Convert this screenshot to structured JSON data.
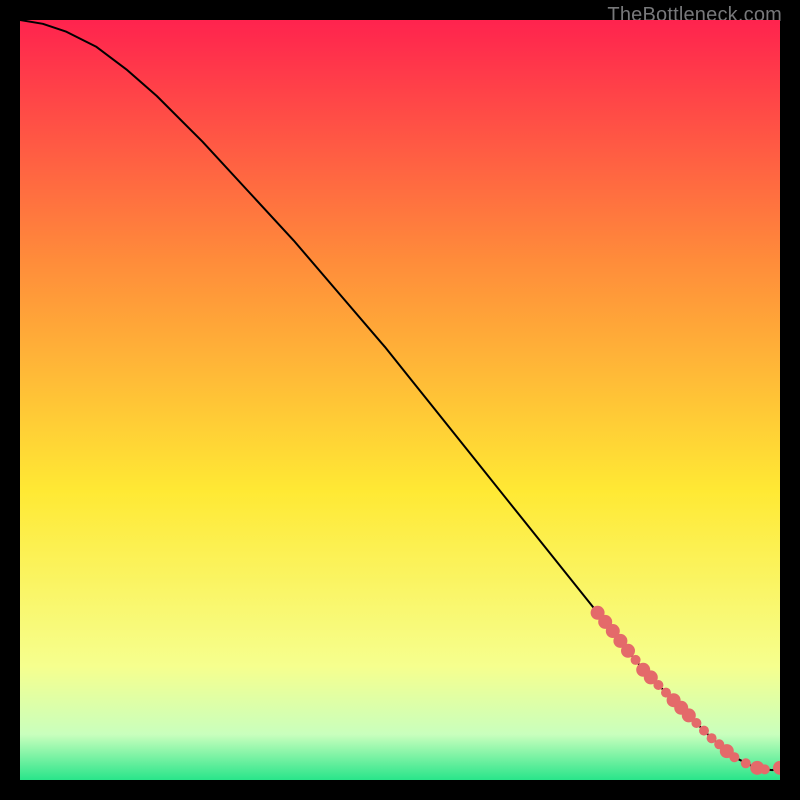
{
  "watermark": "TheBottleneck.com",
  "chart_data": {
    "type": "line",
    "title": "",
    "xlabel": "",
    "ylabel": "",
    "xlim": [
      0,
      100
    ],
    "ylim": [
      0,
      100
    ],
    "grid": false,
    "background_gradient": {
      "top": "#ff234e",
      "mid1": "#ff8d3a",
      "mid2": "#ffe934",
      "mid3": "#f6ff8e",
      "mid4": "#c9ffbd",
      "bottom": "#29e58a"
    },
    "series": [
      {
        "name": "bottleneck-curve",
        "x": [
          0,
          3,
          6,
          10,
          14,
          18,
          24,
          30,
          36,
          42,
          48,
          54,
          60,
          66,
          72,
          76,
          80,
          82,
          85,
          88,
          91,
          94,
          97,
          99,
          100
        ],
        "y": [
          100,
          99.5,
          98.5,
          96.5,
          93.5,
          90,
          84,
          77.5,
          71,
          64,
          57,
          49.5,
          42,
          34.5,
          27,
          22,
          17,
          14.5,
          11.5,
          8.5,
          5.5,
          3,
          1.5,
          1.3,
          1.6
        ],
        "stroke": "#000000",
        "stroke_width": 2
      }
    ],
    "markers": {
      "name": "highlight-dots",
      "color": "#e46a6a",
      "radius_small": 5,
      "radius_large": 7,
      "points": [
        {
          "x": 76.0,
          "y": 22.0,
          "r": 7
        },
        {
          "x": 77.0,
          "y": 20.8,
          "r": 7
        },
        {
          "x": 78.0,
          "y": 19.6,
          "r": 7
        },
        {
          "x": 79.0,
          "y": 18.3,
          "r": 7
        },
        {
          "x": 80.0,
          "y": 17.0,
          "r": 7
        },
        {
          "x": 81.0,
          "y": 15.8,
          "r": 5
        },
        {
          "x": 82.0,
          "y": 14.5,
          "r": 7
        },
        {
          "x": 83.0,
          "y": 13.5,
          "r": 7
        },
        {
          "x": 84.0,
          "y": 12.5,
          "r": 5
        },
        {
          "x": 85.0,
          "y": 11.5,
          "r": 5
        },
        {
          "x": 86.0,
          "y": 10.5,
          "r": 7
        },
        {
          "x": 87.0,
          "y": 9.5,
          "r": 7
        },
        {
          "x": 88.0,
          "y": 8.5,
          "r": 7
        },
        {
          "x": 89.0,
          "y": 7.5,
          "r": 5
        },
        {
          "x": 90.0,
          "y": 6.5,
          "r": 5
        },
        {
          "x": 91.0,
          "y": 5.5,
          "r": 5
        },
        {
          "x": 92.0,
          "y": 4.7,
          "r": 5
        },
        {
          "x": 93.0,
          "y": 3.8,
          "r": 7
        },
        {
          "x": 94.0,
          "y": 3.0,
          "r": 5
        },
        {
          "x": 95.5,
          "y": 2.2,
          "r": 5
        },
        {
          "x": 97.0,
          "y": 1.6,
          "r": 7
        },
        {
          "x": 98.0,
          "y": 1.4,
          "r": 5
        },
        {
          "x": 100.0,
          "y": 1.6,
          "r": 7
        }
      ]
    }
  }
}
